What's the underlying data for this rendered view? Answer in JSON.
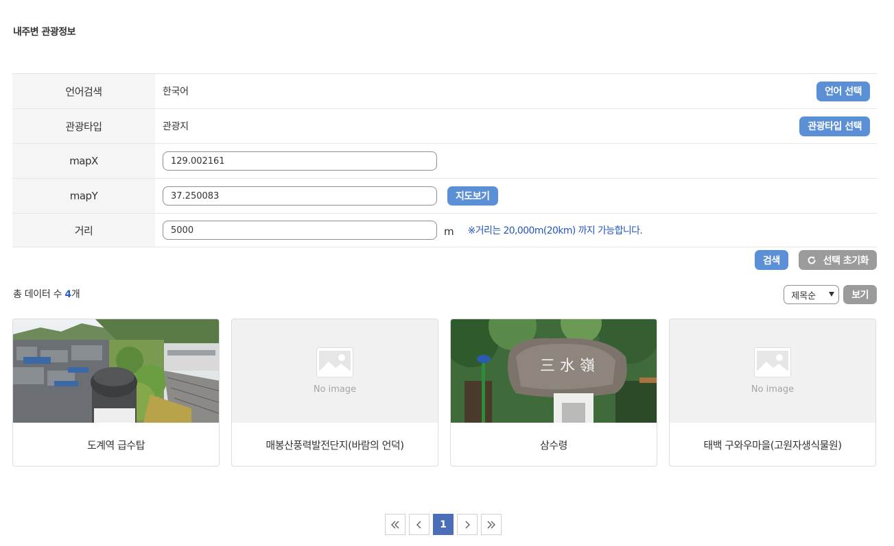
{
  "page": {
    "title": "내주변 관광정보"
  },
  "form": {
    "language": {
      "label": "언어검색",
      "value": "한국어",
      "button": "언어 선택"
    },
    "tour_type": {
      "label": "관광타입",
      "value": "관광지",
      "button": "관광타입 선택"
    },
    "map_x": {
      "label": "mapX",
      "value": "129.002161"
    },
    "map_y": {
      "label": "mapY",
      "value": "37.250083",
      "button": "지도보기"
    },
    "distance": {
      "label": "거리",
      "value": "5000",
      "unit": "m",
      "note": "※거리는 20,000m(20km) 까지 가능합니다."
    }
  },
  "actions": {
    "search": "검색",
    "reset": "선택 초기화"
  },
  "results": {
    "total_prefix": "총 데이터 수 ",
    "total_count": "4",
    "total_suffix": "개",
    "sort_selected": "제목순",
    "view_button": "보기",
    "no_image_label": "No image",
    "items": [
      {
        "name": "도계역 급수탑",
        "has_image": true
      },
      {
        "name": "매봉산풍력발전단지(바람의 언덕)",
        "has_image": false
      },
      {
        "name": "삼수령",
        "has_image": true
      },
      {
        "name": "태백 구와우마을(고원자생식물원)",
        "has_image": false
      }
    ]
  },
  "pagination": {
    "current": "1"
  },
  "colors": {
    "primary_button": "#5b8fd6",
    "secondary_button": "#9b9b9b",
    "accent_text": "#2354c4",
    "pager_active": "#4a6fb8"
  },
  "icons": {
    "reset": "refresh-icon",
    "first": "double-chevron-left-icon",
    "prev": "chevron-left-icon",
    "next": "chevron-right-icon",
    "last": "double-chevron-right-icon",
    "placeholder": "image-placeholder-icon"
  }
}
